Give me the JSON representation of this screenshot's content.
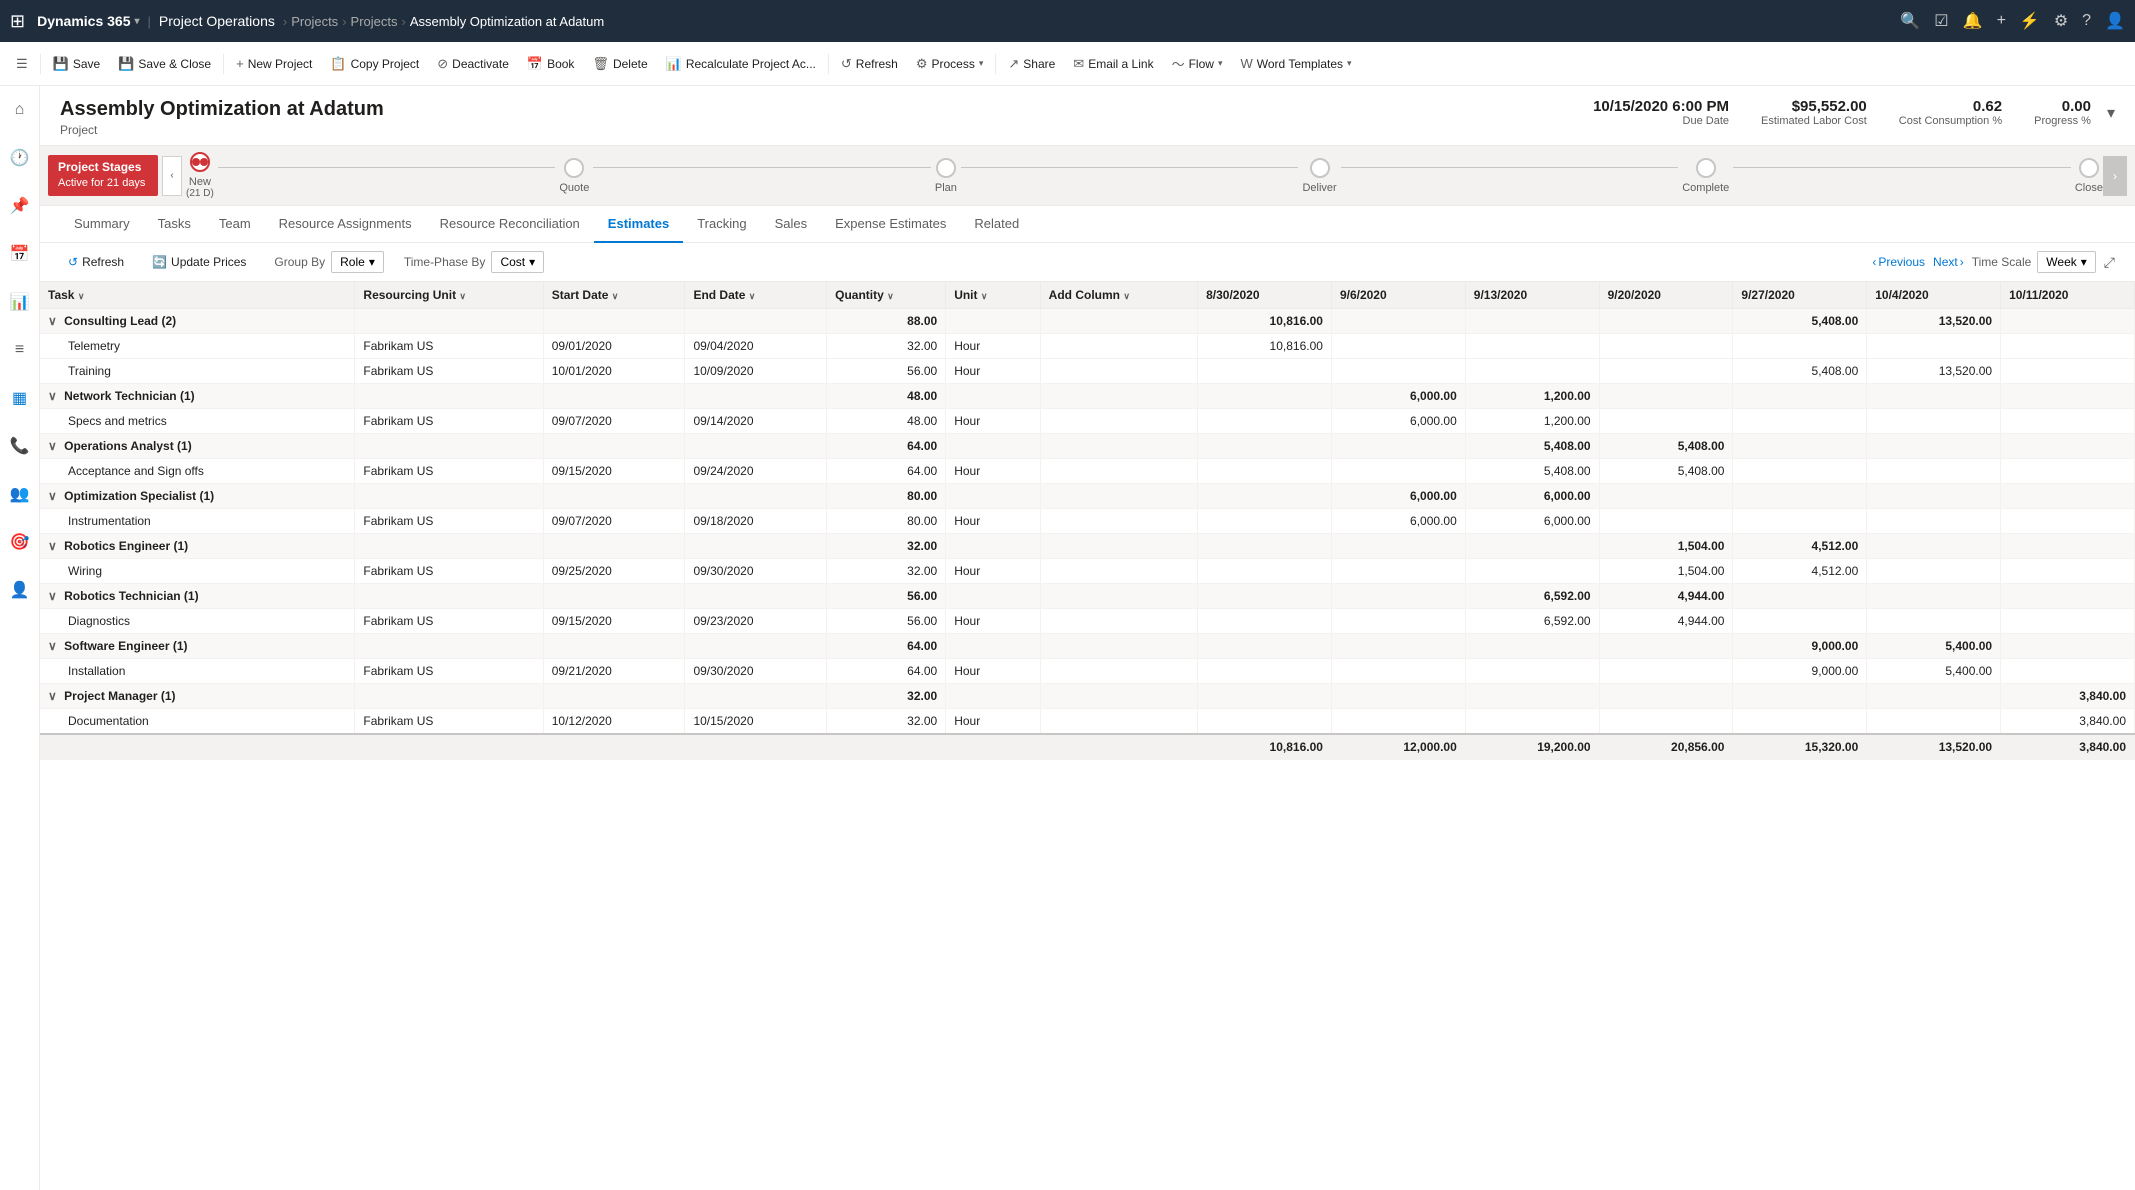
{
  "topNav": {
    "appGrid": "⊞",
    "brand": "Dynamics 365",
    "brandChevron": "▾",
    "moduleName": "Project Operations",
    "breadcrumbs": [
      "Projects",
      "Projects",
      "Assembly Optimization at Adatum"
    ],
    "navIcons": [
      "🔍",
      "☑",
      "🔔",
      "+",
      "⚡",
      "⚙",
      "?",
      "👤"
    ]
  },
  "commandBar": {
    "buttons": [
      {
        "id": "menu-btn",
        "icon": "☰",
        "label": ""
      },
      {
        "id": "save-btn",
        "icon": "💾",
        "label": "Save"
      },
      {
        "id": "save-close-btn",
        "icon": "💾",
        "label": "Save & Close"
      },
      {
        "id": "new-project-btn",
        "icon": "+",
        "label": "New Project"
      },
      {
        "id": "copy-project-btn",
        "icon": "📋",
        "label": "Copy Project"
      },
      {
        "id": "deactivate-btn",
        "icon": "⊘",
        "label": "Deactivate"
      },
      {
        "id": "book-btn",
        "icon": "📅",
        "label": "Book"
      },
      {
        "id": "delete-btn",
        "icon": "🗑",
        "label": "Delete"
      },
      {
        "id": "recalculate-btn",
        "icon": "📊",
        "label": "Recalculate Project Ac..."
      },
      {
        "id": "refresh-btn",
        "icon": "↺",
        "label": "Refresh"
      },
      {
        "id": "process-btn",
        "icon": "⚙",
        "label": "Process",
        "hasChevron": true
      },
      {
        "id": "share-btn",
        "icon": "↗",
        "label": "Share"
      },
      {
        "id": "email-link-btn",
        "icon": "✉",
        "label": "Email a Link"
      },
      {
        "id": "flow-btn",
        "icon": "~",
        "label": "Flow",
        "hasChevron": true
      },
      {
        "id": "word-templates-btn",
        "icon": "W",
        "label": "Word Templates",
        "hasChevron": true
      }
    ]
  },
  "sidebar": {
    "icons": [
      {
        "id": "home",
        "symbol": "⌂"
      },
      {
        "id": "recent",
        "symbol": "🕐"
      },
      {
        "id": "pinned",
        "symbol": "📌"
      },
      {
        "id": "calendar",
        "symbol": "📅"
      },
      {
        "id": "chart",
        "symbol": "📊"
      },
      {
        "id": "list",
        "symbol": "≡"
      },
      {
        "id": "grid-active",
        "symbol": "▦",
        "isActive": true
      },
      {
        "id": "phone",
        "symbol": "📞"
      },
      {
        "id": "people",
        "symbol": "👥"
      },
      {
        "id": "target",
        "symbol": "🎯"
      },
      {
        "id": "person",
        "symbol": "👤"
      }
    ]
  },
  "project": {
    "title": "Assembly Optimization at Adatum",
    "subtitle": "Project",
    "meta": {
      "dueDate": {
        "value": "10/15/2020 6:00 PM",
        "label": "Due Date"
      },
      "estimatedLaborCost": {
        "value": "$95,552.00",
        "label": "Estimated Labor Cost"
      },
      "costConsumption": {
        "value": "0.62",
        "label": "Cost Consumption %"
      },
      "progress": {
        "value": "0.00",
        "label": "Progress %"
      }
    }
  },
  "stages": {
    "activeLabel": "Project Stages",
    "activeSub": "Active for 21 days",
    "items": [
      {
        "id": "new",
        "label": "New",
        "sublabel": "(21 D)",
        "isActive": true
      },
      {
        "id": "quote",
        "label": "Quote",
        "sublabel": ""
      },
      {
        "id": "plan",
        "label": "Plan",
        "sublabel": ""
      },
      {
        "id": "deliver",
        "label": "Deliver",
        "sublabel": ""
      },
      {
        "id": "complete",
        "label": "Complete",
        "sublabel": ""
      },
      {
        "id": "close",
        "label": "Close",
        "sublabel": ""
      }
    ]
  },
  "tabs": [
    {
      "id": "summary",
      "label": "Summary"
    },
    {
      "id": "tasks",
      "label": "Tasks"
    },
    {
      "id": "team",
      "label": "Team"
    },
    {
      "id": "resource-assignments",
      "label": "Resource Assignments"
    },
    {
      "id": "resource-reconciliation",
      "label": "Resource Reconciliation"
    },
    {
      "id": "estimates",
      "label": "Estimates",
      "isActive": true
    },
    {
      "id": "tracking",
      "label": "Tracking"
    },
    {
      "id": "sales",
      "label": "Sales"
    },
    {
      "id": "expense-estimates",
      "label": "Expense Estimates"
    },
    {
      "id": "related",
      "label": "Related"
    }
  ],
  "estimatesToolbar": {
    "refreshLabel": "Refresh",
    "updatePricesLabel": "Update Prices",
    "groupByLabel": "Group By",
    "groupByValue": "Role",
    "timePhaseByLabel": "Time-Phase By",
    "timePhaseByValue": "Cost",
    "previousLabel": "Previous",
    "nextLabel": "Next",
    "timeScaleLabel": "Time Scale",
    "timeScaleValue": "Week"
  },
  "gridHeaders": {
    "task": "Task",
    "resourcingUnit": "Resourcing Unit",
    "startDate": "Start Date",
    "endDate": "End Date",
    "quantity": "Quantity",
    "unit": "Unit",
    "addColumn": "Add Column",
    "weeks": [
      "8/30/2020",
      "9/6/2020",
      "9/13/2020",
      "9/20/2020",
      "9/27/2020",
      "10/4/2020",
      "10/11/2020"
    ]
  },
  "gridRows": [
    {
      "type": "group",
      "label": "Consulting Lead (2)",
      "quantity": "88.00",
      "w1": "10,816.00",
      "w2": "",
      "w3": "",
      "w4": "",
      "w5": "5,408.00",
      "w6": "13,520.00",
      "w7": ""
    },
    {
      "type": "data",
      "task": "Telemetry",
      "resUnit": "Fabrikam US",
      "startDate": "09/01/2020",
      "endDate": "09/04/2020",
      "quantity": "32.00",
      "unit": "Hour",
      "w1": "10,816.00",
      "w2": "",
      "w3": "",
      "w4": "",
      "w5": "",
      "w6": "",
      "w7": ""
    },
    {
      "type": "data",
      "task": "Training",
      "resUnit": "Fabrikam US",
      "startDate": "10/01/2020",
      "endDate": "10/09/2020",
      "quantity": "56.00",
      "unit": "Hour",
      "w1": "",
      "w2": "",
      "w3": "",
      "w4": "",
      "w5": "5,408.00",
      "w6": "13,520.00",
      "w7": ""
    },
    {
      "type": "group",
      "label": "Network Technician (1)",
      "quantity": "48.00",
      "w1": "",
      "w2": "6,000.00",
      "w3": "1,200.00",
      "w4": "",
      "w5": "",
      "w6": "",
      "w7": ""
    },
    {
      "type": "data",
      "task": "Specs and metrics",
      "resUnit": "Fabrikam US",
      "startDate": "09/07/2020",
      "endDate": "09/14/2020",
      "quantity": "48.00",
      "unit": "Hour",
      "w1": "",
      "w2": "6,000.00",
      "w3": "1,200.00",
      "w4": "",
      "w5": "",
      "w6": "",
      "w7": ""
    },
    {
      "type": "group",
      "label": "Operations Analyst (1)",
      "quantity": "64.00",
      "w1": "",
      "w2": "",
      "w3": "5,408.00",
      "w4": "5,408.00",
      "w5": "",
      "w6": "",
      "w7": ""
    },
    {
      "type": "data",
      "task": "Acceptance and Sign offs",
      "resUnit": "Fabrikam US",
      "startDate": "09/15/2020",
      "endDate": "09/24/2020",
      "quantity": "64.00",
      "unit": "Hour",
      "w1": "",
      "w2": "",
      "w3": "5,408.00",
      "w4": "5,408.00",
      "w5": "",
      "w6": "",
      "w7": ""
    },
    {
      "type": "group",
      "label": "Optimization Specialist (1)",
      "quantity": "80.00",
      "w1": "",
      "w2": "6,000.00",
      "w3": "6,000.00",
      "w4": "",
      "w5": "",
      "w6": "",
      "w7": ""
    },
    {
      "type": "data",
      "task": "Instrumentation",
      "resUnit": "Fabrikam US",
      "startDate": "09/07/2020",
      "endDate": "09/18/2020",
      "quantity": "80.00",
      "unit": "Hour",
      "w1": "",
      "w2": "6,000.00",
      "w3": "6,000.00",
      "w4": "",
      "w5": "",
      "w6": "",
      "w7": ""
    },
    {
      "type": "group",
      "label": "Robotics Engineer (1)",
      "quantity": "32.00",
      "w1": "",
      "w2": "",
      "w3": "",
      "w4": "1,504.00",
      "w5": "4,512.00",
      "w6": "",
      "w7": ""
    },
    {
      "type": "data",
      "task": "Wiring",
      "resUnit": "Fabrikam US",
      "startDate": "09/25/2020",
      "endDate": "09/30/2020",
      "quantity": "32.00",
      "unit": "Hour",
      "w1": "",
      "w2": "",
      "w3": "",
      "w4": "1,504.00",
      "w5": "4,512.00",
      "w6": "",
      "w7": ""
    },
    {
      "type": "group",
      "label": "Robotics Technician (1)",
      "quantity": "56.00",
      "w1": "",
      "w2": "",
      "w3": "6,592.00",
      "w4": "4,944.00",
      "w5": "",
      "w6": "",
      "w7": ""
    },
    {
      "type": "data",
      "task": "Diagnostics",
      "resUnit": "Fabrikam US",
      "startDate": "09/15/2020",
      "endDate": "09/23/2020",
      "quantity": "56.00",
      "unit": "Hour",
      "w1": "",
      "w2": "",
      "w3": "6,592.00",
      "w4": "4,944.00",
      "w5": "",
      "w6": "",
      "w7": ""
    },
    {
      "type": "group",
      "label": "Software Engineer (1)",
      "quantity": "64.00",
      "w1": "",
      "w2": "",
      "w3": "",
      "w4": "",
      "w5": "9,000.00",
      "w6": "5,400.00",
      "w7": ""
    },
    {
      "type": "data",
      "task": "Installation",
      "resUnit": "Fabrikam US",
      "startDate": "09/21/2020",
      "endDate": "09/30/2020",
      "quantity": "64.00",
      "unit": "Hour",
      "w1": "",
      "w2": "",
      "w3": "",
      "w4": "",
      "w5": "9,000.00",
      "w6": "5,400.00",
      "w7": ""
    },
    {
      "type": "group",
      "label": "Project Manager (1)",
      "quantity": "32.00",
      "w1": "",
      "w2": "",
      "w3": "",
      "w4": "",
      "w5": "",
      "w6": "",
      "w7": "3,840.00"
    },
    {
      "type": "data",
      "task": "Documentation",
      "resUnit": "Fabrikam US",
      "startDate": "10/12/2020",
      "endDate": "10/15/2020",
      "quantity": "32.00",
      "unit": "Hour",
      "w1": "",
      "w2": "",
      "w3": "",
      "w4": "",
      "w5": "",
      "w6": "",
      "w7": "3,840.00"
    }
  ],
  "gridFooter": {
    "w1": "10,816.00",
    "w2": "12,000.00",
    "w3": "19,200.00",
    "w4": "20,856.00",
    "w5": "15,320.00",
    "w6": "13,520.00",
    "w7": "3,840.00"
  }
}
